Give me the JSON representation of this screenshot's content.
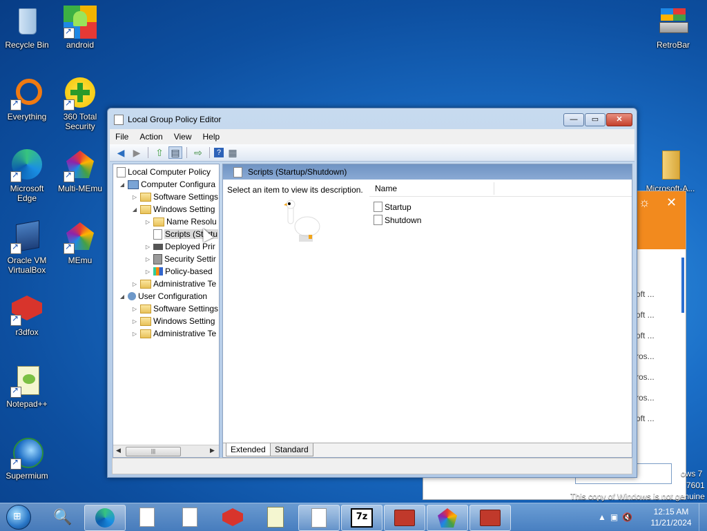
{
  "desktop": {
    "icons": [
      {
        "label": "Recycle Bin"
      },
      {
        "label": "android"
      },
      {
        "label": "Everything"
      },
      {
        "label": "360 Total Security"
      },
      {
        "label": "Microsoft Edge"
      },
      {
        "label": "Multi-MEmu"
      },
      {
        "label": "Oracle VM VirtualBox"
      },
      {
        "label": "MEmu"
      },
      {
        "label": "r3dfox"
      },
      {
        "label": "Notepad++"
      },
      {
        "label": "Supermium"
      },
      {
        "label": "RetroBar"
      },
      {
        "label": "Microsoft-A..."
      }
    ],
    "watermark": {
      "line1": "ows 7",
      "line2": "7601",
      "line3": "This copy of Windows is not genuine"
    }
  },
  "back_window": {
    "rows": [
      "oft ...",
      "oft ...",
      "oft ...",
      "ros...",
      "ros...",
      "ros...",
      "oft ..."
    ]
  },
  "window": {
    "title": "Local Group Policy Editor",
    "minimize": "—",
    "maximize": "▭",
    "close": "✕",
    "menu": [
      "File",
      "Action",
      "View",
      "Help"
    ],
    "tree": [
      {
        "label": "Local Computer Policy"
      },
      {
        "label": "Computer Configura"
      },
      {
        "label": "Software Settings"
      },
      {
        "label": "Windows Setting"
      },
      {
        "label": "Name Resolu"
      },
      {
        "label": "Scripts (Startu"
      },
      {
        "label": "Deployed Prir"
      },
      {
        "label": "Security Settir"
      },
      {
        "label": "Policy-based"
      },
      {
        "label": "Administrative Te"
      },
      {
        "label": "User Configuration"
      },
      {
        "label": "Software Settings"
      },
      {
        "label": "Windows Setting"
      },
      {
        "label": "Administrative Te"
      }
    ],
    "header": "Scripts (Startup/Shutdown)",
    "description": "Select an item to view its description.",
    "column_name": "Name",
    "items": [
      "Startup",
      "Shutdown"
    ],
    "tabs": [
      "Extended",
      "Standard"
    ]
  },
  "taskbar": {
    "time": "12:15 AM",
    "date": "11/21/2024"
  },
  "colors": {
    "accent": "#f28a1e",
    "header": "#7a9ccc"
  }
}
